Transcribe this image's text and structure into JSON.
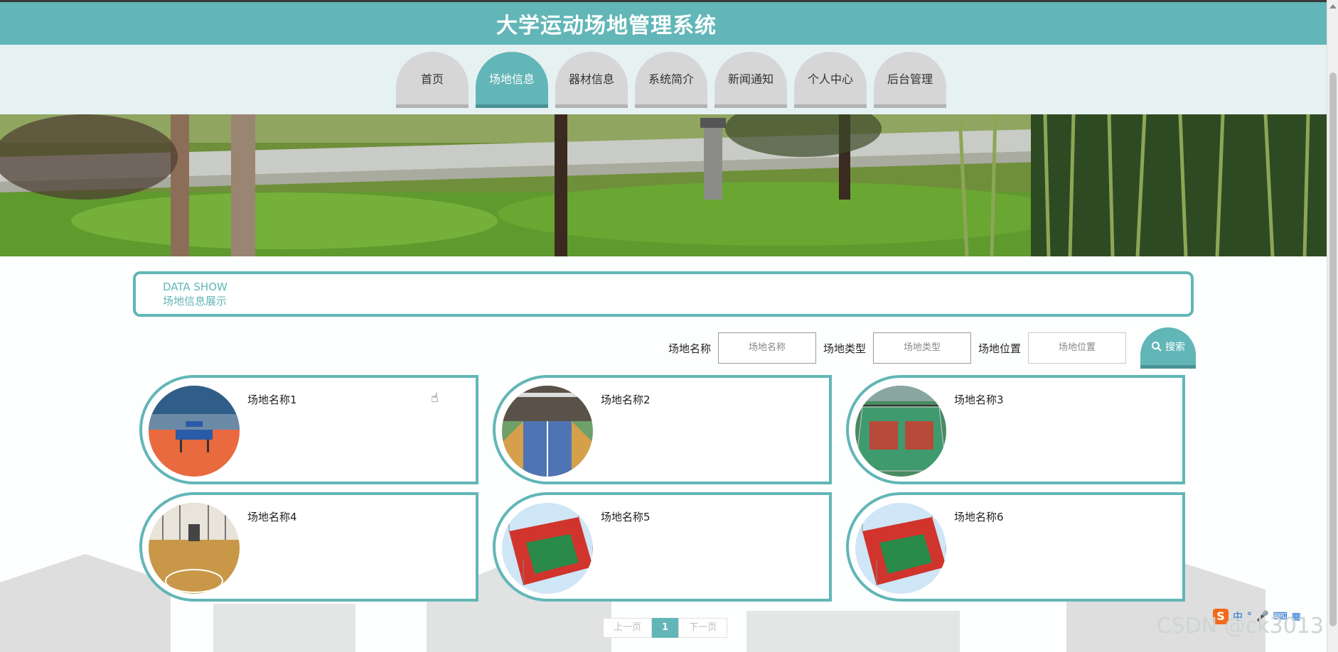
{
  "app": {
    "title": "大学运动场地管理系统"
  },
  "nav": [
    {
      "label": "首页",
      "active": false
    },
    {
      "label": "场地信息",
      "active": true
    },
    {
      "label": "器材信息",
      "active": false
    },
    {
      "label": "系统简介",
      "active": false
    },
    {
      "label": "新闻通知",
      "active": false
    },
    {
      "label": "个人中心",
      "active": false
    },
    {
      "label": "后台管理",
      "active": false
    }
  ],
  "section": {
    "en": "DATA SHOW",
    "cn": "场地信息展示"
  },
  "search": {
    "name_label": "场地名称",
    "name_placeholder": "场地名称",
    "type_label": "场地类型",
    "type_placeholder": "场地类型",
    "location_label": "场地位置",
    "location_placeholder": "场地位置",
    "button_label": "搜索"
  },
  "venues": [
    {
      "name": "场地名称1",
      "image": "table-tennis-hall"
    },
    {
      "name": "场地名称2",
      "image": "badminton-hall"
    },
    {
      "name": "场地名称3",
      "image": "outdoor-basketball-court"
    },
    {
      "name": "场地名称4",
      "image": "indoor-wooden-court"
    },
    {
      "name": "场地名称5",
      "image": "fenced-red-court"
    },
    {
      "name": "场地名称6",
      "image": "fenced-red-court"
    }
  ],
  "pagination": {
    "prev": "上一页",
    "current": "1",
    "next": "下一页"
  },
  "watermark": "CSDN @ck3013",
  "ime": {
    "logo": "S",
    "lang": "中"
  },
  "colors": {
    "accent": "#62b6b7",
    "accent_dark": "#4a9496",
    "tab_inactive": "#d6d6d6"
  }
}
